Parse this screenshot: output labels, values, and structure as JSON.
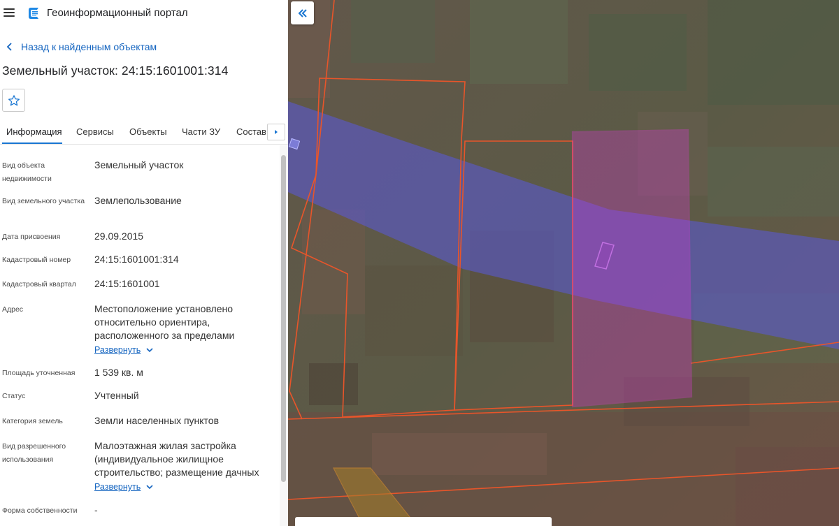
{
  "header": {
    "title": "Геоинформационный портал"
  },
  "navigation": {
    "back_label": "Назад к найденным объектам"
  },
  "object": {
    "title": "Земельный участок: 24:15:1601001:314"
  },
  "tabs": [
    {
      "label": "Информация",
      "active": true
    },
    {
      "label": "Сервисы",
      "active": false
    },
    {
      "label": "Объекты",
      "active": false
    },
    {
      "label": "Части ЗУ",
      "active": false
    },
    {
      "label": "Состав",
      "active": false
    }
  ],
  "properties": [
    {
      "label": "Вид объекта недвижимости",
      "value": "Земельный участок"
    },
    {
      "label": "Вид земельного участка",
      "value": "Землепользование"
    },
    {
      "label": "Дата присвоения",
      "value": "29.09.2015"
    },
    {
      "label": "Кадастровый номер",
      "value": "24:15:1601001:314"
    },
    {
      "label": "Кадастровый квартал",
      "value": "24:15:1601001"
    },
    {
      "label": "Адрес",
      "value": "Местоположение установлено относительно ориентира, расположенного за пределами",
      "expand_label": "Развернуть"
    },
    {
      "label": "Площадь уточненная",
      "value": "1 539 кв. м"
    },
    {
      "label": "Статус",
      "value": "Учтенный"
    },
    {
      "label": "Категория земель",
      "value": "Земли населенных пунктов"
    },
    {
      "label": "Вид разрешенного использования",
      "value": "Малоэтажная жилая застройка (индивидуальное жилищное строительство; размещение дачных",
      "expand_label": "Развернуть"
    },
    {
      "label": "Форма собственности",
      "value": "-"
    }
  ],
  "icons": {
    "menu": "hamburger-menu-icon",
    "logo": "portal-logo-icon",
    "back": "chevron-left-icon",
    "favorite": "star-outline-icon",
    "tabs_next": "triangle-right-icon",
    "expand": "chevron-down-icon",
    "collapse_panel": "double-chevron-left-icon"
  },
  "colors": {
    "accent": "#1976d2",
    "link": "#1565c0",
    "parcel_outline": "#e8552a",
    "selected_parcel": "#d63ad0",
    "zone_fill": "#5a5adc"
  }
}
